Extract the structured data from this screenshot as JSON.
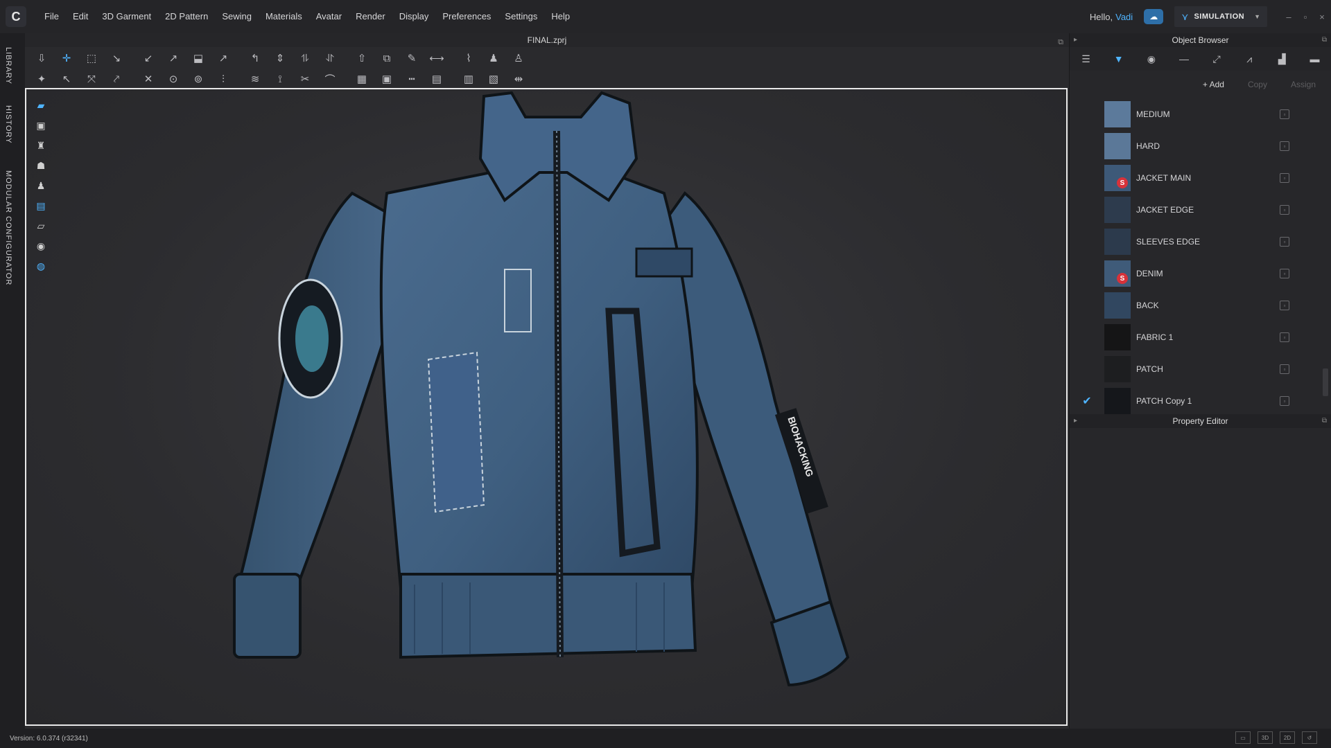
{
  "app": {
    "logo_glyph": "C",
    "menu": [
      "File",
      "Edit",
      "3D Garment",
      "2D Pattern",
      "Sewing",
      "Materials",
      "Avatar",
      "Render",
      "Display",
      "Preferences",
      "Settings",
      "Help"
    ],
    "greeting_prefix": "Hello,",
    "user_name": "Vadi",
    "mode_label": "SIMULATION",
    "window_controls": [
      "–",
      "▫",
      "×"
    ]
  },
  "side_tabs": [
    "LIBRARY",
    "HISTORY",
    "MODULAR CONFIGURATOR"
  ],
  "workspace": {
    "file_name": "FINAL.zprj",
    "toolbar_row1_icons": [
      "move-down-icon",
      "select-move-icon",
      "transform-box-icon",
      "sim-point-icon",
      "pin-icon",
      "tack-icon",
      "flatten-icon",
      "segment-icon",
      "edit-curvature-icon",
      "arrangement-icon",
      "fold-icon",
      "fold-arrangement-icon",
      "strengthen-icon",
      "pin-garment-icon",
      "steam-icon",
      "measure-icon",
      "tape-icon",
      "show-avatar-icon",
      "hide-avatar-icon"
    ],
    "toolbar_row2_icons": [
      "avatar-pose-icon",
      "sewing-line-icon",
      "free-sewing-icon",
      "segment-sewing-icon",
      "multi-sewing-icon",
      "button-icon",
      "buttonhole-icon",
      "zipper-icon",
      "puckering-icon",
      "elastic-icon",
      "trim-icon",
      "piping-icon",
      "texture-icon",
      "graphic-icon",
      "topstitch-icon",
      "layout-icon",
      "fabric-icon",
      "pattern-icon",
      "split-icon"
    ],
    "viewport_tools": [
      "garment-view-icon",
      "shirt-view-icon",
      "fabric-icon",
      "avatar-icon",
      "avatar-posture-icon",
      "layer-icon",
      "eraser-icon",
      "avatar-shadow-icon",
      "globe-icon"
    ],
    "garment_patch_text": "BIOHACKING",
    "colors": {
      "jacket": "#3f5f80",
      "jacket_dark": "#2c4663",
      "stitch": "#c9d4dd",
      "accent": "#4fb4ff"
    }
  },
  "object_browser": {
    "title": "Object Browser",
    "tab_icons": [
      "list-icon",
      "fabric-icon",
      "button-icon",
      "topstitch-icon",
      "zipper-icon",
      "piping-icon",
      "graphic-icon",
      "trim-icon"
    ],
    "add_label": "+ Add",
    "copy_label": "Copy",
    "assign_label": "Assign",
    "items": [
      {
        "name": "MEDIUM",
        "color": "#5c7a9b",
        "badge": false,
        "checked": false
      },
      {
        "name": "HARD",
        "color": "#5b7898",
        "badge": false,
        "checked": false
      },
      {
        "name": "JACKET MAIN",
        "color": "#3d5978",
        "badge": true,
        "checked": false
      },
      {
        "name": "JACKET EDGE",
        "color": "#2d3b4d",
        "badge": false,
        "checked": false
      },
      {
        "name": "SLEEVES EDGE",
        "color": "#2c3a4c",
        "badge": false,
        "checked": false
      },
      {
        "name": "DENIM",
        "color": "#3f5b79",
        "badge": true,
        "checked": false
      },
      {
        "name": "BACK",
        "color": "#314760",
        "badge": false,
        "checked": false
      },
      {
        "name": "FABRIC 1",
        "color": "#151516",
        "badge": false,
        "checked": false
      },
      {
        "name": "PATCH",
        "color": "#1d1e20",
        "badge": false,
        "checked": false
      },
      {
        "name": "PATCH Copy 1",
        "color": "#15171b",
        "badge": false,
        "checked": true
      }
    ]
  },
  "property_editor": {
    "title": "Property Editor"
  },
  "status": {
    "version": "Version: 6.0.374 (r32341)",
    "view_buttons": [
      "▭",
      "3D",
      "2D",
      "↺"
    ]
  }
}
